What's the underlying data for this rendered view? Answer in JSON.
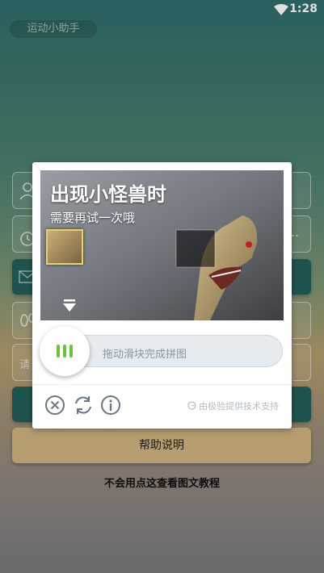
{
  "status_bar": {
    "time": "1:28"
  },
  "app": {
    "title": "运动小助手"
  },
  "form": {
    "hint_partial": "请",
    "more_glyph": "..."
  },
  "help_button": {
    "label": "帮助说明"
  },
  "tutorial_link": {
    "label": "不会用点这查看图文教程"
  },
  "captcha": {
    "puzzle_title": "出现小怪兽时",
    "puzzle_subtitle": "需要再试一次哦",
    "slider_hint": "拖动滑块完成拼图",
    "brand_text": "由极验提供技术支持",
    "slider_accent": "#6cc334"
  }
}
